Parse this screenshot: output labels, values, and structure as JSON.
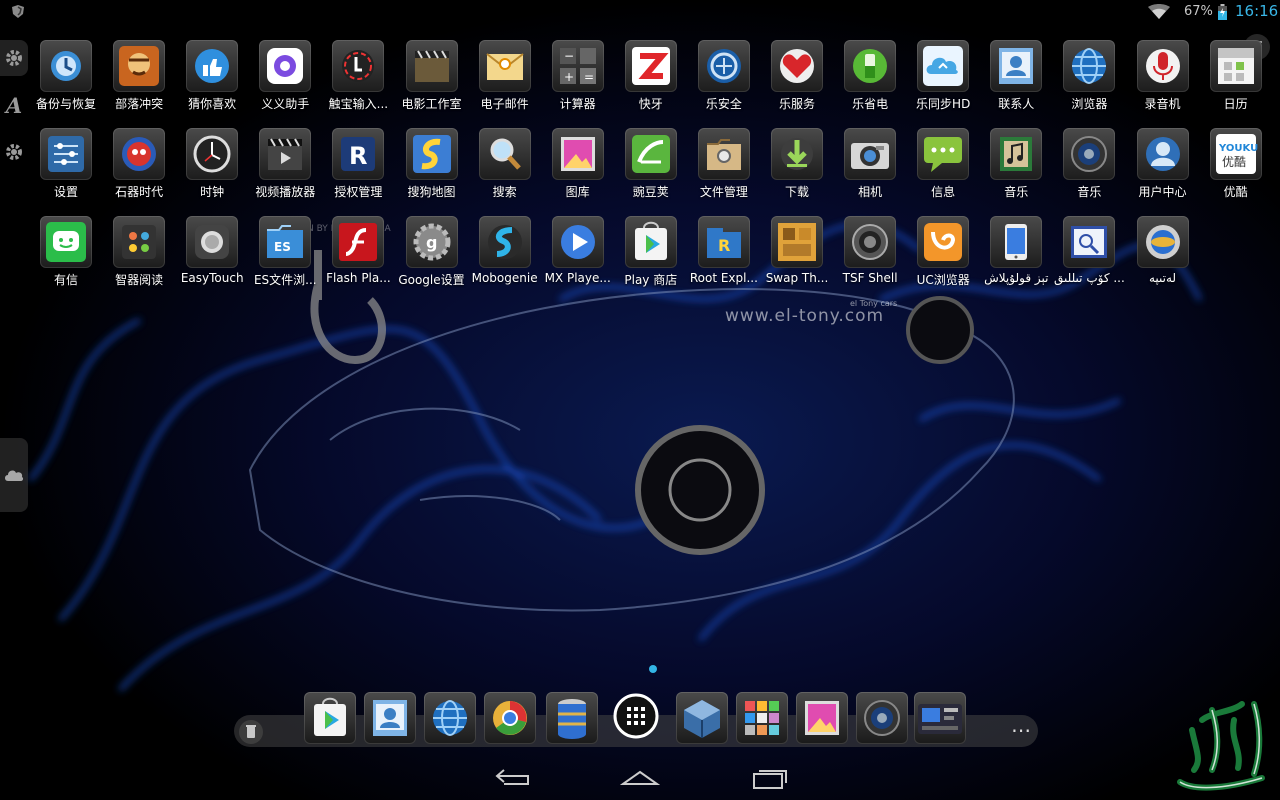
{
  "status_bar": {
    "battery_percent": "67%",
    "time": "16:16",
    "accent": "#33b5e5",
    "icons": [
      "shield-icon",
      "wifi-icon",
      "battery-icon"
    ]
  },
  "watermark": {
    "url": "www.el-tony.com",
    "sub": "el Tony cars",
    "top": "GN BY EL TONY KHA"
  },
  "apps": [
    {
      "label": "备份与恢复",
      "icon": "backup-restore-icon"
    },
    {
      "label": "部落冲突",
      "icon": "clash-of-clans-icon"
    },
    {
      "label": "猜你喜欢",
      "icon": "thumbs-up-icon"
    },
    {
      "label": "义义助手",
      "icon": "assistant-icon"
    },
    {
      "label": "触宝输入...",
      "icon": "touchpal-icon"
    },
    {
      "label": "电影工作室",
      "icon": "movie-studio-icon"
    },
    {
      "label": "电子邮件",
      "icon": "email-icon"
    },
    {
      "label": "计算器",
      "icon": "calculator-icon"
    },
    {
      "label": "快牙",
      "icon": "zapya-icon"
    },
    {
      "label": "乐安全",
      "icon": "security-icon"
    },
    {
      "label": "乐服务",
      "icon": "lenovo-service-icon"
    },
    {
      "label": "乐省电",
      "icon": "battery-saver-icon"
    },
    {
      "label": "乐同步HD",
      "icon": "cloud-sync-icon"
    },
    {
      "label": "联系人",
      "icon": "contacts-icon"
    },
    {
      "label": "浏览器",
      "icon": "browser-globe-icon"
    },
    {
      "label": "录音机",
      "icon": "recorder-icon"
    },
    {
      "label": "日历",
      "icon": "calendar-icon"
    },
    {
      "label": "设置",
      "icon": "settings-sliders-icon"
    },
    {
      "label": "石器时代",
      "icon": "stone-age-icon"
    },
    {
      "label": "时钟",
      "icon": "clock-icon"
    },
    {
      "label": "视频播放器",
      "icon": "video-player-icon"
    },
    {
      "label": "授权管理",
      "icon": "authorization-icon"
    },
    {
      "label": "搜狗地图",
      "icon": "sogou-map-icon"
    },
    {
      "label": "搜索",
      "icon": "search-icon"
    },
    {
      "label": "图库",
      "icon": "gallery-icon"
    },
    {
      "label": "豌豆荚",
      "icon": "wandoujia-icon"
    },
    {
      "label": "文件管理",
      "icon": "file-manager-icon"
    },
    {
      "label": "下载",
      "icon": "download-icon"
    },
    {
      "label": "相机",
      "icon": "camera-icon"
    },
    {
      "label": "信息",
      "icon": "messages-icon"
    },
    {
      "label": "音乐",
      "icon": "music-icon"
    },
    {
      "label": "音乐",
      "icon": "speaker-icon"
    },
    {
      "label": "用户中心",
      "icon": "user-center-icon"
    },
    {
      "label": "优酷",
      "icon": "youku-icon"
    },
    {
      "label": "有信",
      "icon": "youxin-icon"
    },
    {
      "label": "智器阅读",
      "icon": "reader-icon"
    },
    {
      "label": "EasyTouch",
      "icon": "easytouch-icon"
    },
    {
      "label": "ES文件浏...",
      "icon": "es-file-explorer-icon"
    },
    {
      "label": "Flash Pla...",
      "icon": "flash-player-icon"
    },
    {
      "label": "Google设置",
      "icon": "google-settings-icon"
    },
    {
      "label": "Mobogenie",
      "icon": "mobogenie-icon"
    },
    {
      "label": "MX Playe...",
      "icon": "mx-player-icon"
    },
    {
      "label": "Play 商店",
      "icon": "play-store-icon"
    },
    {
      "label": "Root Expl...",
      "icon": "root-explorer-icon"
    },
    {
      "label": "Swap Th...",
      "icon": "swap-icon"
    },
    {
      "label": "TSF Shell",
      "icon": "tsf-shell-icon"
    },
    {
      "label": "UC浏览器",
      "icon": "uc-browser-icon"
    },
    {
      "label": "تېز قولۇپلاش",
      "icon": "phone-lock-icon"
    },
    {
      "label": "كۆپ تىللىق ...",
      "icon": "dictionary-icon"
    },
    {
      "label": "لەتىپە",
      "icon": "latipa-icon"
    }
  ],
  "dock": {
    "items": [
      "play-store-icon",
      "contacts-icon",
      "browser-globe-icon",
      "chrome-icon",
      "database-icon",
      "apps-drawer-icon",
      "cube-icon",
      "tiles-grid-icon",
      "gallery-icon",
      "speaker-icon",
      "tsf-widget-icon"
    ]
  },
  "logo_text": "تالىپ تۈرى"
}
